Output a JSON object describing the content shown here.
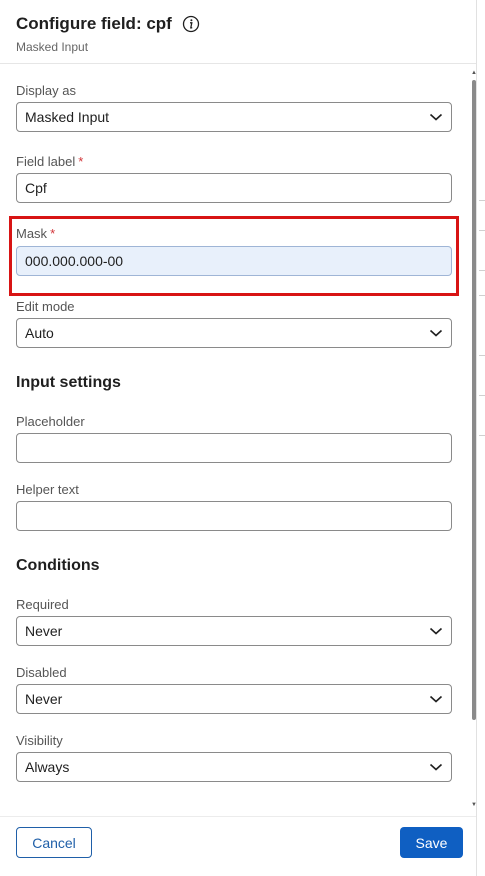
{
  "header": {
    "title": "Configure field: cpf",
    "subtitle": "Masked Input"
  },
  "fields": {
    "display_as": {
      "label": "Display as",
      "value": "Masked Input"
    },
    "field_label": {
      "label": "Field label",
      "required_mark": "*",
      "value": "Cpf"
    },
    "mask": {
      "label": "Mask",
      "required_mark": "*",
      "value": "000.000.000-00"
    },
    "edit_mode": {
      "label": "Edit mode",
      "value": "Auto"
    }
  },
  "input_settings": {
    "heading": "Input settings",
    "placeholder": {
      "label": "Placeholder",
      "value": ""
    },
    "helper_text": {
      "label": "Helper text",
      "value": ""
    }
  },
  "conditions": {
    "heading": "Conditions",
    "required": {
      "label": "Required",
      "value": "Never"
    },
    "disabled": {
      "label": "Disabled",
      "value": "Never"
    },
    "visibility": {
      "label": "Visibility",
      "value": "Always"
    }
  },
  "footer": {
    "cancel_label": "Cancel",
    "save_label": "Save"
  },
  "colors": {
    "primary": "#0f5fc2",
    "highlight": "#d81414",
    "required": "#d13438"
  },
  "icons": [
    "info-icon",
    "chevron-down-icon"
  ]
}
